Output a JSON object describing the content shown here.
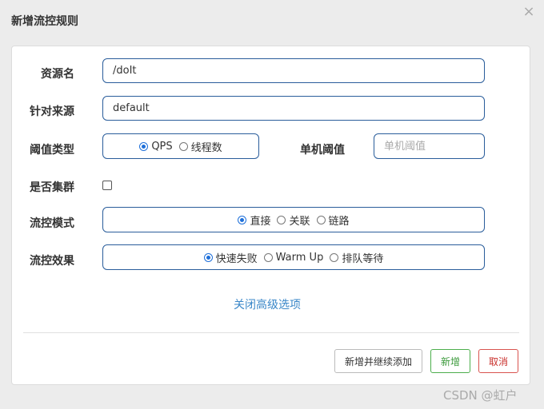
{
  "dialog": {
    "title": "新增流控规则",
    "close_symbol": "×"
  },
  "form": {
    "resource": {
      "label": "资源名",
      "value": "/doIt"
    },
    "source": {
      "label": "针对来源",
      "value": "default"
    },
    "threshold_type": {
      "label": "阈值类型",
      "options": [
        {
          "label": "QPS",
          "selected": true
        },
        {
          "label": "线程数",
          "selected": false
        }
      ]
    },
    "single_threshold": {
      "label": "单机阈值",
      "placeholder": "单机阈值",
      "value": ""
    },
    "cluster": {
      "label": "是否集群",
      "checked": false
    },
    "flow_mode": {
      "label": "流控模式",
      "options": [
        {
          "label": "直接",
          "selected": true
        },
        {
          "label": "关联",
          "selected": false
        },
        {
          "label": "链路",
          "selected": false
        }
      ]
    },
    "flow_effect": {
      "label": "流控效果",
      "options": [
        {
          "label": "快速失败",
          "selected": true
        },
        {
          "label": "Warm Up",
          "selected": false
        },
        {
          "label": "排队等待",
          "selected": false
        }
      ]
    },
    "advanced_link": "关闭高级选项"
  },
  "footer": {
    "add_continue": "新增并继续添加",
    "save": "新增",
    "cancel": "取消"
  },
  "watermark": "CSDN @虹户",
  "colors": {
    "input_border": "#2a5d9b",
    "link": "#3a87c8",
    "save": "#4cae4c",
    "cancel": "#d9534f"
  }
}
